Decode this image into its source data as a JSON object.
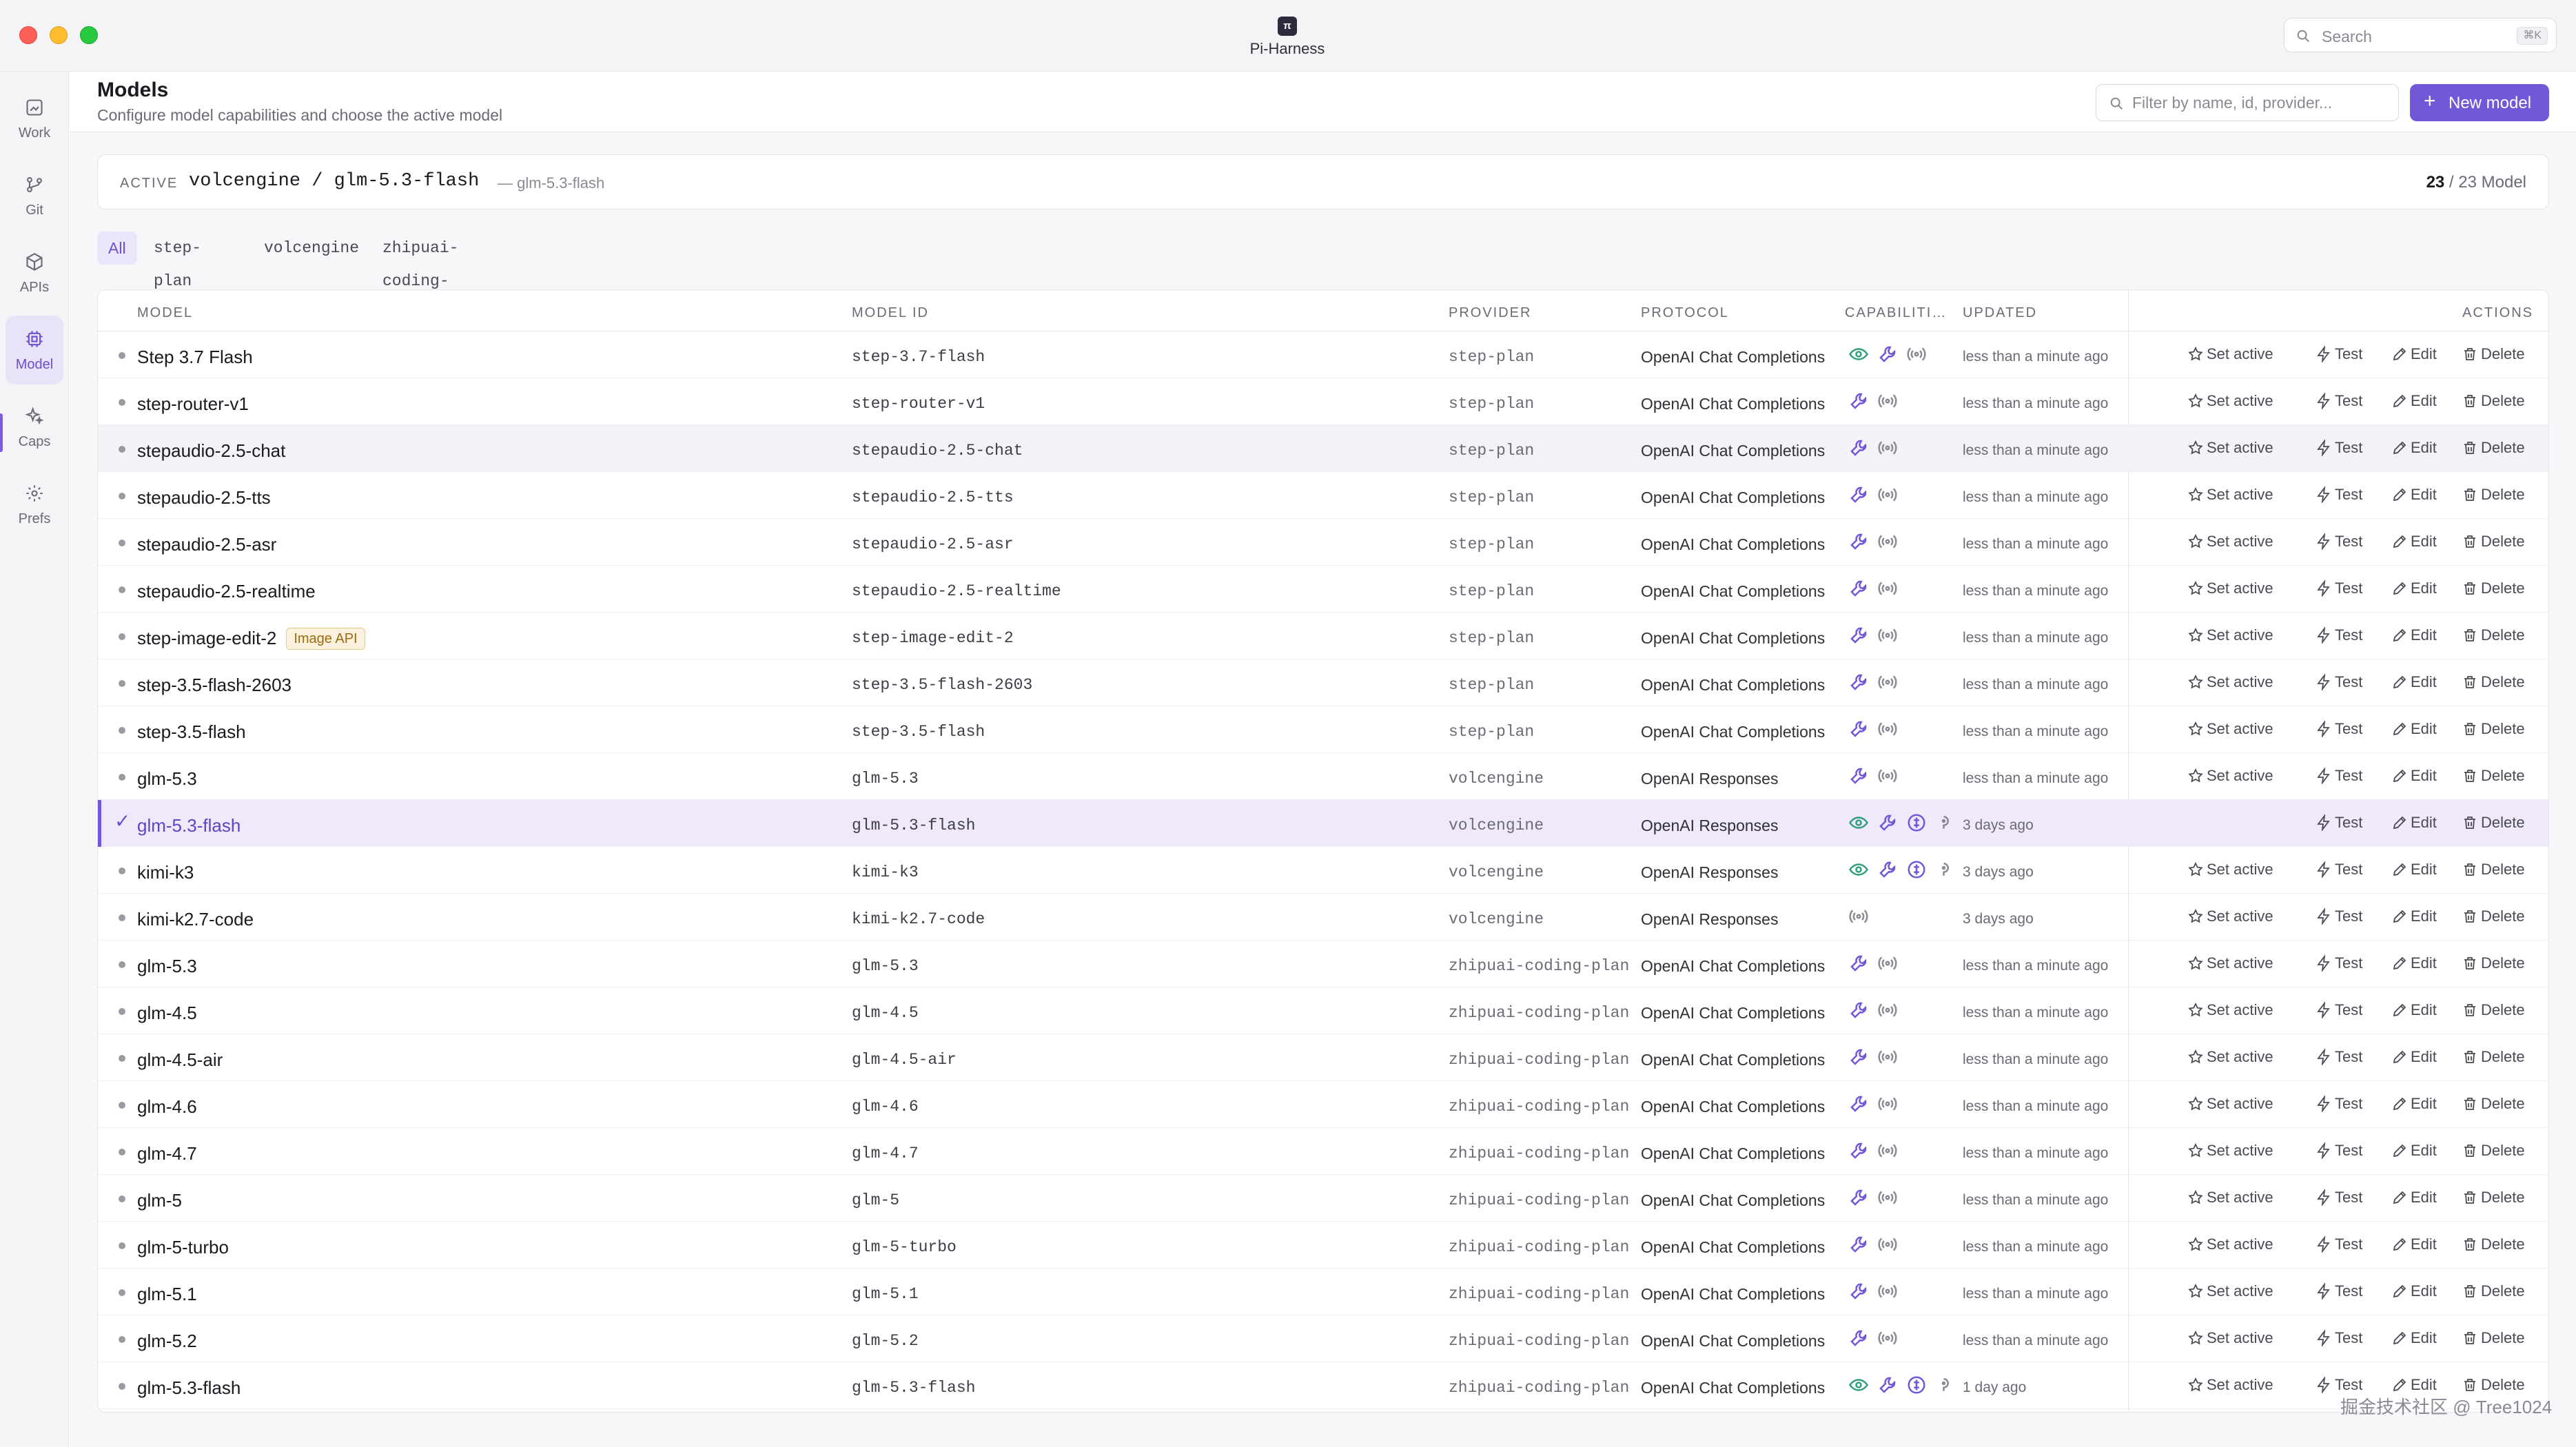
{
  "window": {
    "app_title": "Pi-Harness",
    "app_icon_text": "π",
    "search_label": "Search",
    "search_shortcut": "⌘K"
  },
  "sidebar": {
    "items": [
      {
        "label": "Work",
        "icon": "work-icon"
      },
      {
        "label": "Git",
        "icon": "git-branch-icon"
      },
      {
        "label": "APIs",
        "icon": "cube-icon"
      },
      {
        "label": "Model",
        "icon": "cpu-chip-icon"
      },
      {
        "label": "Caps",
        "icon": "sparkles-icon"
      },
      {
        "label": "Prefs",
        "icon": "gear-icon"
      }
    ],
    "active_index": 3
  },
  "header": {
    "title": "Models",
    "subtitle": "Configure model capabilities and choose the active model",
    "filter_placeholder": "Filter by name, id, provider...",
    "new_button": "New model"
  },
  "active_model": {
    "tag": "ACTIVE",
    "name": "volcengine / glm-5.3-flash",
    "id": "— glm-5.3-flash",
    "count_current": "23",
    "count_rest": " / 23 Model"
  },
  "chips": [
    "All",
    "step-plan",
    "volcengine",
    "zhipuai-coding-plan"
  ],
  "table": {
    "columns": {
      "model": "MODEL",
      "model_id": "MODEL ID",
      "provider": "PROVIDER",
      "protocol": "PROTOCOL",
      "capabilities": "CAPABILITI…",
      "updated": "UPDATED",
      "actions": "ACTIONS"
    },
    "action_labels": {
      "set_active": "Set active",
      "test": "Test",
      "edit": "Edit",
      "delete": "Delete"
    },
    "rows": [
      {
        "name": "Step 3.7 Flash",
        "badge": "",
        "id": "step-3.7-flash",
        "provider": "step-plan",
        "protocol": "OpenAI Chat Completions",
        "caps": [
          "vision",
          "tools",
          "streaming"
        ],
        "updated": "less than a minute ago",
        "active": false
      },
      {
        "name": "step-router-v1",
        "badge": "",
        "id": "step-router-v1",
        "provider": "step-plan",
        "protocol": "OpenAI Chat Completions",
        "caps": [
          "tools",
          "streaming"
        ],
        "updated": "less than a minute ago",
        "active": false
      },
      {
        "name": "stepaudio-2.5-chat",
        "badge": "",
        "id": "stepaudio-2.5-chat",
        "provider": "step-plan",
        "protocol": "OpenAI Chat Completions",
        "caps": [
          "tools",
          "streaming"
        ],
        "updated": "less than a minute ago",
        "active": false
      },
      {
        "name": "stepaudio-2.5-tts",
        "badge": "",
        "id": "stepaudio-2.5-tts",
        "provider": "step-plan",
        "protocol": "OpenAI Chat Completions",
        "caps": [
          "tools",
          "streaming"
        ],
        "updated": "less than a minute ago",
        "active": false
      },
      {
        "name": "stepaudio-2.5-asr",
        "badge": "",
        "id": "stepaudio-2.5-asr",
        "provider": "step-plan",
        "protocol": "OpenAI Chat Completions",
        "caps": [
          "tools",
          "streaming"
        ],
        "updated": "less than a minute ago",
        "active": false
      },
      {
        "name": "stepaudio-2.5-realtime",
        "badge": "",
        "id": "stepaudio-2.5-realtime",
        "provider": "step-plan",
        "protocol": "OpenAI Chat Completions",
        "caps": [
          "tools",
          "streaming"
        ],
        "updated": "less than a minute ago",
        "active": false
      },
      {
        "name": "step-image-edit-2",
        "badge": "Image API",
        "id": "step-image-edit-2",
        "provider": "step-plan",
        "protocol": "OpenAI Chat Completions",
        "caps": [
          "tools",
          "streaming"
        ],
        "updated": "less than a minute ago",
        "active": false
      },
      {
        "name": "step-3.5-flash-2603",
        "badge": "",
        "id": "step-3.5-flash-2603",
        "provider": "step-plan",
        "protocol": "OpenAI Chat Completions",
        "caps": [
          "tools",
          "streaming"
        ],
        "updated": "less than a minute ago",
        "active": false
      },
      {
        "name": "step-3.5-flash",
        "badge": "",
        "id": "step-3.5-flash",
        "provider": "step-plan",
        "protocol": "OpenAI Chat Completions",
        "caps": [
          "tools",
          "streaming"
        ],
        "updated": "less than a minute ago",
        "active": false
      },
      {
        "name": "glm-5.3",
        "badge": "",
        "id": "glm-5.3",
        "provider": "volcengine",
        "protocol": "OpenAI Responses",
        "caps": [
          "tools",
          "streaming"
        ],
        "updated": "less than a minute ago",
        "active": false
      },
      {
        "name": "glm-5.3-flash",
        "badge": "",
        "id": "glm-5.3-flash",
        "provider": "volcengine",
        "protocol": "OpenAI Responses",
        "caps": [
          "vision",
          "tools",
          "reasoning",
          "thinking"
        ],
        "updated": "3 days ago",
        "active": true
      },
      {
        "name": "kimi-k3",
        "badge": "",
        "id": "kimi-k3",
        "provider": "volcengine",
        "protocol": "OpenAI Responses",
        "caps": [
          "vision",
          "tools",
          "reasoning",
          "thinking"
        ],
        "updated": "3 days ago",
        "active": false
      },
      {
        "name": "kimi-k2.7-code",
        "badge": "",
        "id": "kimi-k2.7-code",
        "provider": "volcengine",
        "protocol": "OpenAI Responses",
        "caps": [
          "streaming"
        ],
        "updated": "3 days ago",
        "active": false
      },
      {
        "name": "glm-5.3",
        "badge": "",
        "id": "glm-5.3",
        "provider": "zhipuai-coding-plan",
        "protocol": "OpenAI Chat Completions",
        "caps": [
          "tools",
          "streaming"
        ],
        "updated": "less than a minute ago",
        "active": false
      },
      {
        "name": "glm-4.5",
        "badge": "",
        "id": "glm-4.5",
        "provider": "zhipuai-coding-plan",
        "protocol": "OpenAI Chat Completions",
        "caps": [
          "tools",
          "streaming"
        ],
        "updated": "less than a minute ago",
        "active": false
      },
      {
        "name": "glm-4.5-air",
        "badge": "",
        "id": "glm-4.5-air",
        "provider": "zhipuai-coding-plan",
        "protocol": "OpenAI Chat Completions",
        "caps": [
          "tools",
          "streaming"
        ],
        "updated": "less than a minute ago",
        "active": false
      },
      {
        "name": "glm-4.6",
        "badge": "",
        "id": "glm-4.6",
        "provider": "zhipuai-coding-plan",
        "protocol": "OpenAI Chat Completions",
        "caps": [
          "tools",
          "streaming"
        ],
        "updated": "less than a minute ago",
        "active": false
      },
      {
        "name": "glm-4.7",
        "badge": "",
        "id": "glm-4.7",
        "provider": "zhipuai-coding-plan",
        "protocol": "OpenAI Chat Completions",
        "caps": [
          "tools",
          "streaming"
        ],
        "updated": "less than a minute ago",
        "active": false
      },
      {
        "name": "glm-5",
        "badge": "",
        "id": "glm-5",
        "provider": "zhipuai-coding-plan",
        "protocol": "OpenAI Chat Completions",
        "caps": [
          "tools",
          "streaming"
        ],
        "updated": "less than a minute ago",
        "active": false
      },
      {
        "name": "glm-5-turbo",
        "badge": "",
        "id": "glm-5-turbo",
        "provider": "zhipuai-coding-plan",
        "protocol": "OpenAI Chat Completions",
        "caps": [
          "tools",
          "streaming"
        ],
        "updated": "less than a minute ago",
        "active": false
      },
      {
        "name": "glm-5.1",
        "badge": "",
        "id": "glm-5.1",
        "provider": "zhipuai-coding-plan",
        "protocol": "OpenAI Chat Completions",
        "caps": [
          "tools",
          "streaming"
        ],
        "updated": "less than a minute ago",
        "active": false
      },
      {
        "name": "glm-5.2",
        "badge": "",
        "id": "glm-5.2",
        "provider": "zhipuai-coding-plan",
        "protocol": "OpenAI Chat Completions",
        "caps": [
          "tools",
          "streaming"
        ],
        "updated": "less than a minute ago",
        "active": false
      },
      {
        "name": "glm-5.3-flash",
        "badge": "",
        "id": "glm-5.3-flash",
        "provider": "zhipuai-coding-plan",
        "protocol": "OpenAI Chat Completions",
        "caps": [
          "vision",
          "tools",
          "reasoning",
          "thinking"
        ],
        "updated": "1 day ago",
        "active": false
      }
    ]
  },
  "watermark": "掘金技术社区 @ Tree1024",
  "colors": {
    "accent": "#7357d9",
    "accent_soft": "#efe9fb",
    "vision": "#2f9e7a",
    "tools": "#7357d9",
    "reasoning": "#7357d9",
    "streaming": "#8a8994"
  }
}
